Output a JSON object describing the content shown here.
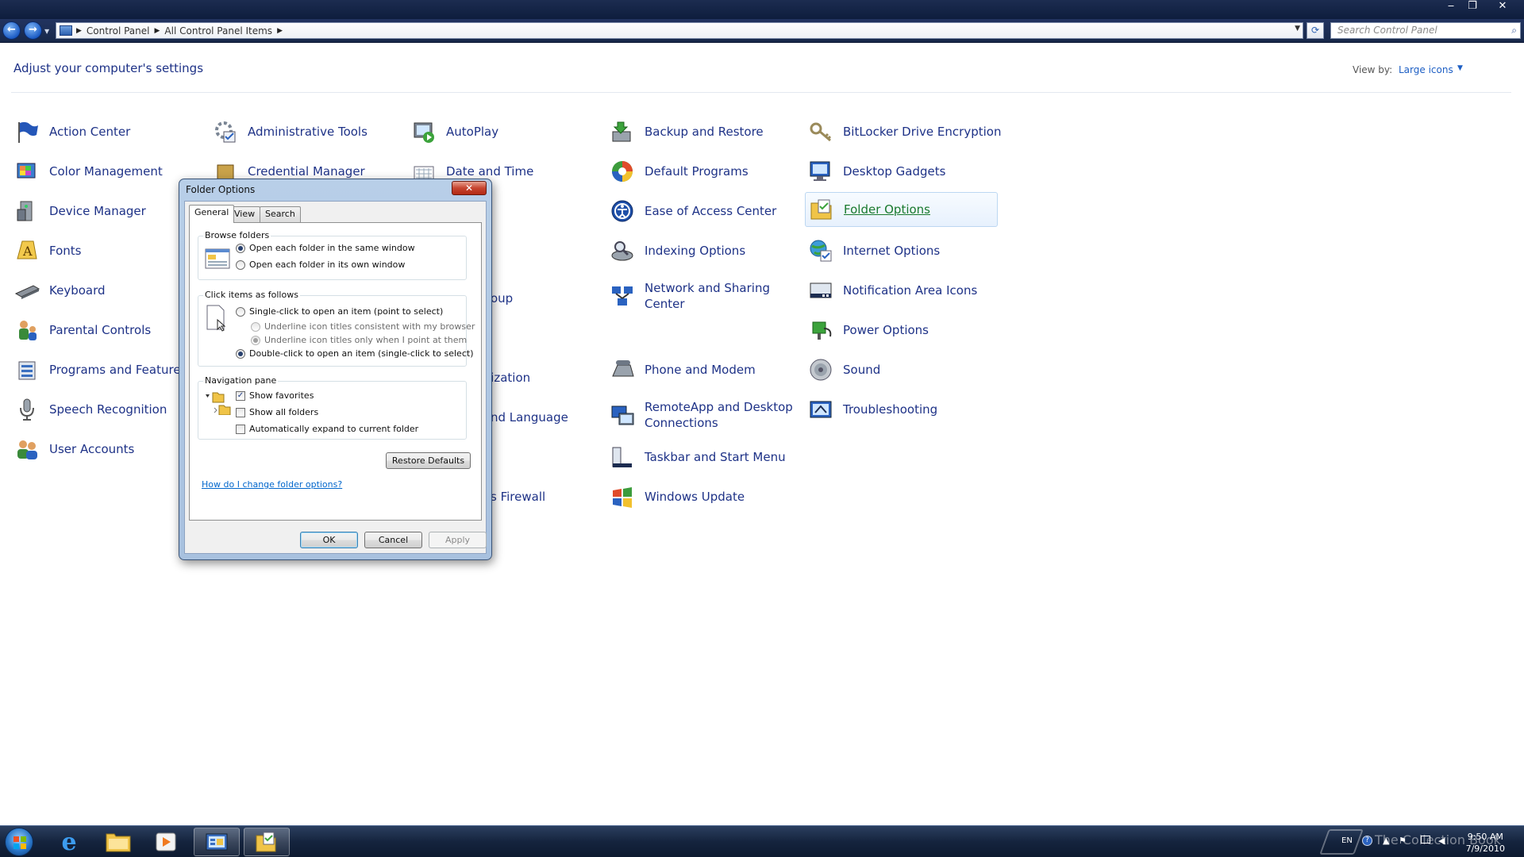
{
  "window": {
    "minimize": "‒",
    "restore": "❐",
    "close": "✕"
  },
  "nav": {
    "back": "←",
    "forward": "→",
    "breadcrumbs": [
      "Control Panel",
      "All Control Panel Items"
    ],
    "search_placeholder": "Search Control Panel"
  },
  "content": {
    "heading": "Adjust your computer's settings",
    "view_by_label": "View by:",
    "view_by_value": "Large icons"
  },
  "items": [
    {
      "label": "Action Center",
      "icon": "flag-icon"
    },
    {
      "label": "Administrative Tools",
      "icon": "admin-tools-icon"
    },
    {
      "label": "AutoPlay",
      "icon": "autoplay-icon"
    },
    {
      "label": "Backup and Restore",
      "icon": "backup-icon"
    },
    {
      "label": "BitLocker Drive Encryption",
      "icon": "key-icon"
    },
    {
      "label": "Color Management",
      "icon": "color-management-icon"
    },
    {
      "label": "Credential Manager",
      "icon": "credential-icon"
    },
    {
      "label": "Date and Time",
      "icon": "calendar-icon"
    },
    {
      "label": "Default Programs",
      "icon": "default-programs-icon"
    },
    {
      "label": "Desktop Gadgets",
      "icon": "gadgets-icon"
    },
    {
      "label": "Device Manager",
      "icon": "device-manager-icon"
    },
    {
      "label": "Ease of Access Center",
      "icon": "ease-of-access-icon"
    },
    {
      "label": "Folder Options",
      "icon": "folder-icon"
    },
    {
      "label": "Fonts",
      "icon": "fonts-icon"
    },
    {
      "label": "oup",
      "icon": ""
    },
    {
      "label": "Indexing Options",
      "icon": "indexing-icon"
    },
    {
      "label": "Internet Options",
      "icon": "internet-icon"
    },
    {
      "label": "Keyboard",
      "icon": "keyboard-icon"
    },
    {
      "label": "Network and Sharing Center",
      "icon": "network-icon"
    },
    {
      "label": "Notification Area Icons",
      "icon": "notification-icon"
    },
    {
      "label": "Parental Controls",
      "icon": "parental-icon"
    },
    {
      "label": "lization",
      "icon": ""
    },
    {
      "label": "Phone and Modem",
      "icon": "phone-icon"
    },
    {
      "label": "Power Options",
      "icon": "power-icon"
    },
    {
      "label": "Programs and Features",
      "icon": "programs-icon"
    },
    {
      "label": "nd Language",
      "icon": ""
    },
    {
      "label": "RemoteApp and Desktop Connections",
      "icon": "remote-icon"
    },
    {
      "label": "Sound",
      "icon": "sound-icon"
    },
    {
      "label": "Speech Recognition",
      "icon": "microphone-icon"
    },
    {
      "label": "Taskbar and Start Menu",
      "icon": "taskbar-icon"
    },
    {
      "label": "Troubleshooting",
      "icon": "troubleshoot-icon"
    },
    {
      "label": "User Accounts",
      "icon": "users-icon"
    },
    {
      "label": "s Firewall",
      "icon": ""
    },
    {
      "label": "Windows Update",
      "icon": "update-icon"
    }
  ],
  "dialog": {
    "title": "Folder Options",
    "close": "✕",
    "tabs": [
      "General",
      "View",
      "Search"
    ],
    "browse": {
      "title": "Browse folders",
      "opt1": "Open each folder in the same window",
      "opt2": "Open each folder in its own window"
    },
    "click": {
      "title": "Click items as follows",
      "opt1": "Single-click to open an item (point to select)",
      "sub1": "Underline icon titles consistent with my browser",
      "sub2": "Underline icon titles only when I point at them",
      "opt2": "Double-click to open an item (single-click to select)"
    },
    "nav": {
      "title": "Navigation pane",
      "opt1": "Show favorites",
      "opt2": "Show all folders",
      "opt3": "Automatically expand to current folder",
      "check": "✓"
    },
    "restore_defaults": "Restore Defaults",
    "help_link": "How do I change folder options?",
    "ok": "OK",
    "cancel": "Cancel",
    "apply": "Apply"
  },
  "taskbar": {
    "lang": "EN",
    "time": "9:50 AM",
    "date": "7/9/2010"
  },
  "watermark": "The Collection Book"
}
